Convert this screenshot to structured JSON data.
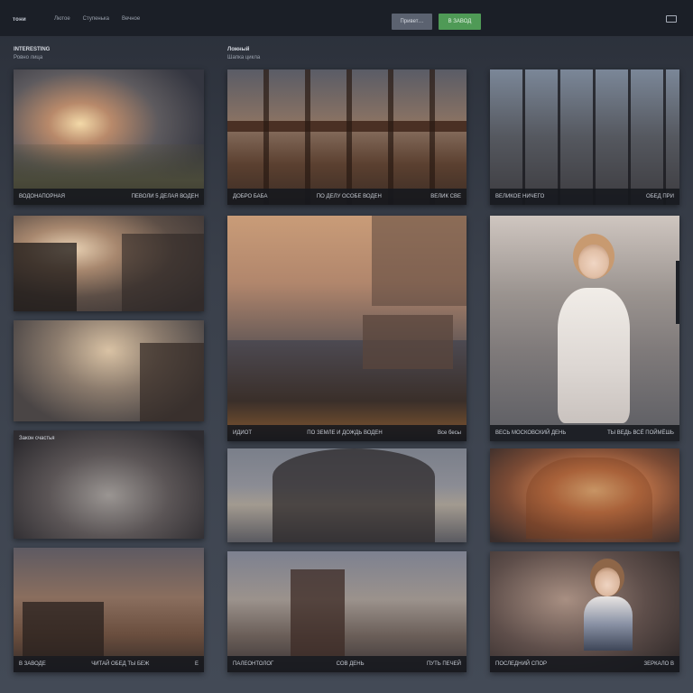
{
  "topbar": {
    "brand": "тони",
    "nav": [
      "Лютое",
      "Ступенька",
      "Вечное"
    ],
    "secondary_button": "Привет…",
    "primary_button": "В ЗАВОД"
  },
  "columns": [
    {
      "title": "INTERESTING",
      "subtitle": "Ровно лица"
    },
    {
      "title": "Ложный",
      "subtitle": "Шапка цикла"
    }
  ],
  "cards": [
    {
      "left": "ВОДОНАПОРНАЯ",
      "right": "ПЕВОЛИ 5 ДЕЛАЯ ВОДЕН"
    },
    {
      "left": "ДОБРО БАБА",
      "mid": "ПО ДЕЛУ ОСОБЕ ВОДЕН",
      "right": "ВЕЛИК СВЕ"
    },
    {
      "left": "ВЕЛИКОЕ НИЧЕГО",
      "right": "ОБЕД ПРИ"
    },
    {
      "left": "",
      "right": ""
    },
    {
      "label": "Закон счастья"
    },
    {
      "left": "ИДИОТ",
      "mid": "ПО ЗЕМЛЕ И ДОЖДЬ ВОДЕН",
      "right": "Все бесы"
    },
    {
      "left": "ВЕСЬ МОСКОВСКИЙ ДЕНЬ",
      "right": "ТЫ ВЕДЬ ВСЁ ПОЙМЁШЬ"
    },
    {
      "left": "В ЗАВОДЕ",
      "mid": "ЧИТАЙ ОБЕД ТЫ БЕЖ",
      "right": "Е"
    },
    {
      "left": "ПАЛЕОНТОЛОГ",
      "mid": "СОВ ДЕНЬ",
      "right": "ПУТЬ ПЕЧЕЙ"
    },
    {
      "left": "ПОСЛЕДНИЙ СПОР",
      "right": "ЗЕРКАЛО В"
    }
  ]
}
